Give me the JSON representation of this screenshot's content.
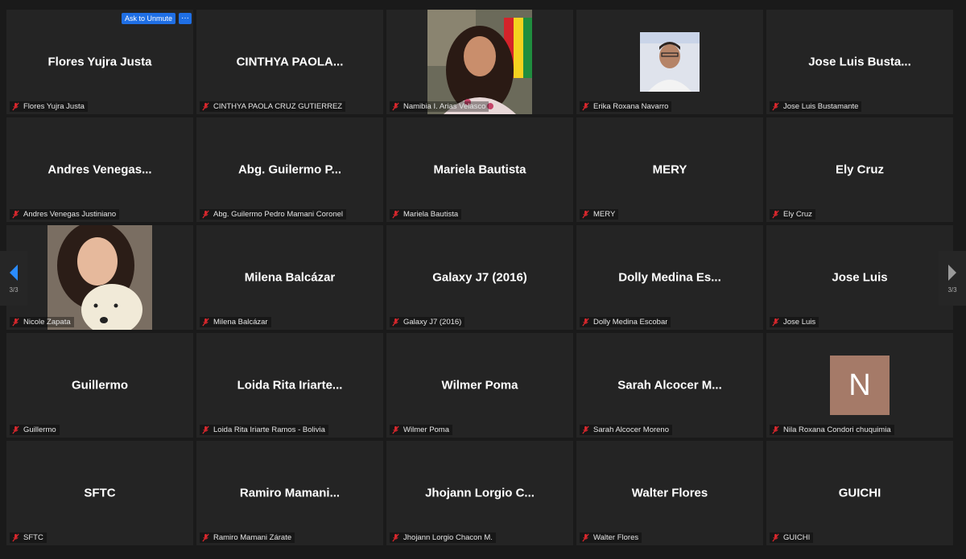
{
  "controls": {
    "ask_to_unmute": "Ask to Unmute",
    "more": "···"
  },
  "pagination": {
    "left_page": "3/3",
    "right_page": "3/3"
  },
  "colors": {
    "tile_bg": "#242424",
    "accent": "#1f6fe5",
    "muted": "#e0282e"
  },
  "participants": [
    {
      "display": "Flores Yujra Justa",
      "name": "Flores Yujra Justa",
      "type": "text"
    },
    {
      "display": "CINTHYA  PAOLA...",
      "name": "CINTHYA PAOLA CRUZ GUTIERREZ",
      "type": "text"
    },
    {
      "display": "",
      "name": "Namibia I. Arias Velasco",
      "type": "video1"
    },
    {
      "display": "",
      "name": "Erika Roxana Navarro",
      "type": "video2"
    },
    {
      "display": "Jose Luis Busta...",
      "name": "Jose Luis Bustamante",
      "type": "text"
    },
    {
      "display": "Andres  Venegas...",
      "name": "Andres Venegas Justiniano",
      "type": "text"
    },
    {
      "display": "Abg. Guilermo  P...",
      "name": "Abg. Guilermo Pedro Mamani Coronel",
      "type": "text"
    },
    {
      "display": "Mariela Bautista",
      "name": "Mariela Bautista",
      "type": "text"
    },
    {
      "display": "MERY",
      "name": "MERY",
      "type": "text"
    },
    {
      "display": "Ely Cruz",
      "name": "Ely Cruz",
      "type": "text"
    },
    {
      "display": "",
      "name": "Nicole Zapata",
      "type": "video3"
    },
    {
      "display": "Milena Balcázar",
      "name": "Milena Balcázar",
      "type": "text"
    },
    {
      "display": "Galaxy J7 (2016)",
      "name": "Galaxy J7 (2016)",
      "type": "text"
    },
    {
      "display": "Dolly  Medina  Es...",
      "name": "Dolly Medina Escobar",
      "type": "text"
    },
    {
      "display": "Jose Luis",
      "name": "Jose Luis",
      "type": "text"
    },
    {
      "display": "Guillermo",
      "name": "Guillermo",
      "type": "text"
    },
    {
      "display": "Loida Rita Iriarte...",
      "name": "Loida Rita Iriarte Ramos - Bolivia",
      "type": "text"
    },
    {
      "display": "Wilmer Poma",
      "name": "Wilmer Poma",
      "type": "text"
    },
    {
      "display": "Sarah  Alcocer  M...",
      "name": "Sarah Alcocer Moreno",
      "type": "text"
    },
    {
      "display": "",
      "name": "Nila Roxana Condori chuquimia",
      "type": "avatar",
      "initial": "N"
    },
    {
      "display": "SFTC",
      "name": "SFTC",
      "type": "text"
    },
    {
      "display": "Ramiro  Mamani...",
      "name": "Ramiro Mamani Zárate",
      "type": "text"
    },
    {
      "display": "Jhojann  Lorgio  C...",
      "name": "Jhojann Lorgio Chacon M.",
      "type": "text"
    },
    {
      "display": "Walter Flores",
      "name": "Walter Flores",
      "type": "text"
    },
    {
      "display": "GUICHI",
      "name": "GUICHI",
      "type": "text"
    }
  ]
}
